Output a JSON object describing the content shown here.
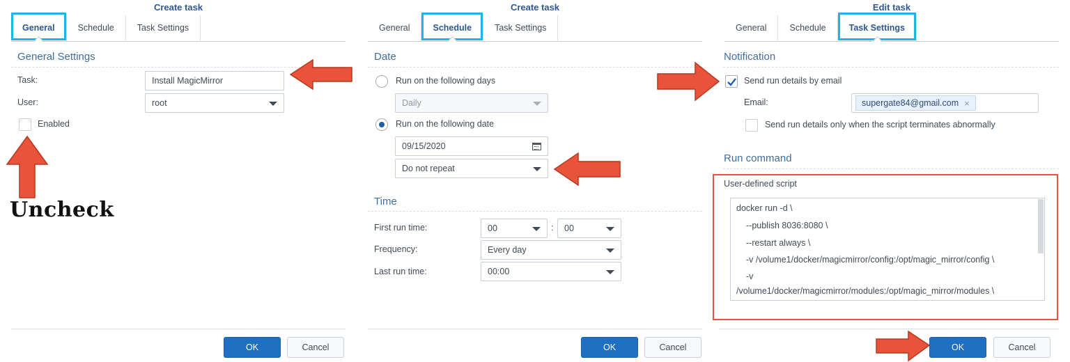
{
  "panel1": {
    "title": "Create task",
    "tabs": [
      "General",
      "Schedule",
      "Task Settings"
    ],
    "section": "General Settings",
    "task_label": "Task:",
    "task_value": "Install MagicMirror",
    "user_label": "User:",
    "user_value": "root",
    "enabled_label": "Enabled",
    "annotation": "Uncheck",
    "ok": "OK",
    "cancel": "Cancel"
  },
  "panel2": {
    "title": "Create task",
    "tabs": [
      "General",
      "Schedule",
      "Task Settings"
    ],
    "date_section": "Date",
    "run_days_label": "Run on the following days",
    "days_value": "Daily",
    "run_date_label": "Run on the following date",
    "date_value": "09/15/2020",
    "repeat_value": "Do not repeat",
    "time_section": "Time",
    "first_run_label": "First run time:",
    "first_run_hour": "00",
    "time_sep": ":",
    "first_run_min": "00",
    "frequency_label": "Frequency:",
    "frequency_value": "Every day",
    "last_run_label": "Last run time:",
    "last_run_value": "00:00",
    "ok": "OK",
    "cancel": "Cancel"
  },
  "panel3": {
    "title": "Edit task",
    "tabs": [
      "General",
      "Schedule",
      "Task Settings"
    ],
    "notification_section": "Notification",
    "send_email_label": "Send run details by email",
    "email_label": "Email:",
    "email_value": "supergate84@gmail.com",
    "tag_remove": "×",
    "abnormal_label": "Send run details only when the script terminates abnormally",
    "run_command_section": "Run command",
    "script_label": "User-defined script",
    "script_lines": [
      "docker run  -d \\",
      "--publish 8036:8080 \\",
      "--restart always \\",
      "-v /volume1/docker/magicmirror/config:/opt/magic_mirror/config \\",
      "-v",
      "/volume1/docker/magicmirror/modules:/opt/magic_mirror/modules \\"
    ],
    "ok": "OK",
    "cancel": "Cancel"
  },
  "colors": {
    "accent_highlight": "#1cb5e8",
    "annotation_arrow": "#e9533b",
    "ok_button": "#1f6fc2",
    "tab_active": "#2d5791"
  },
  "icons": [
    "arrow-annotation-icon",
    "calendar-icon",
    "chevron-down-icon",
    "checkmark-icon",
    "close-icon"
  ]
}
